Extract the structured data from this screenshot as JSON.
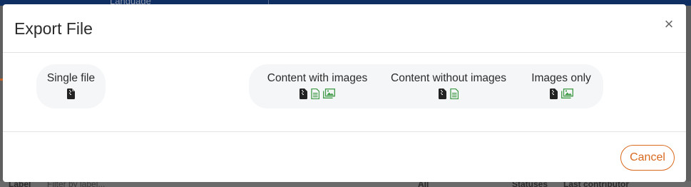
{
  "background": {
    "top_text": "Language",
    "bottom": {
      "label": "Label",
      "filter_placeholder": "Filter by label...",
      "all": "All",
      "statuses": "Statuses",
      "last_contributor": "Last contributor"
    }
  },
  "dialog": {
    "title": "Export File",
    "close_symbol": "×",
    "options": [
      {
        "label": "Single file",
        "icons": [
          "zip-file-icon"
        ]
      },
      {
        "label": "Content with images",
        "icons": [
          "zip-file-icon",
          "document-icon",
          "images-icon"
        ]
      },
      {
        "label": "Content without images",
        "icons": [
          "zip-file-icon",
          "document-icon"
        ]
      },
      {
        "label": "Images only",
        "icons": [
          "zip-file-icon",
          "images-icon"
        ]
      }
    ],
    "cancel_label": "Cancel"
  },
  "colors": {
    "accent": "#d9691f",
    "icon_green": "#3f9a45",
    "icon_dark": "#222222",
    "group_bg": "#f5f6f8"
  }
}
